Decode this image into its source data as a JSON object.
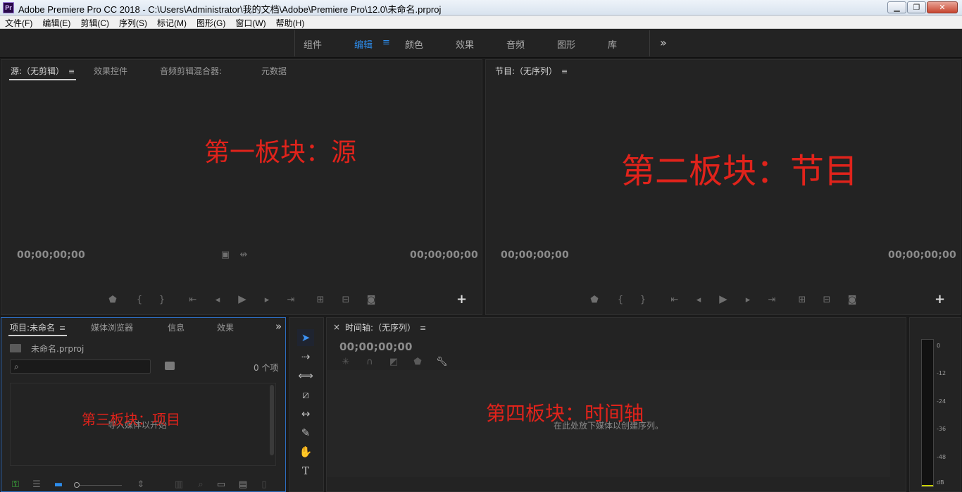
{
  "window": {
    "app_icon": "Pr",
    "title": "Adobe Premiere Pro CC 2018 - C:\\Users\\Administrator\\我的文档\\Adobe\\Premiere Pro\\12.0\\未命名.prproj",
    "minimize": "▁",
    "restore": "❐",
    "close": "✕"
  },
  "menu": [
    "文件(F)",
    "编辑(E)",
    "剪辑(C)",
    "序列(S)",
    "标记(M)",
    "图形(G)",
    "窗口(W)",
    "帮助(H)"
  ],
  "workspaces": {
    "tabs": [
      "组件",
      "编辑",
      "颜色",
      "效果",
      "音频",
      "图形",
      "库"
    ],
    "active": "编辑",
    "hamburger": "≡",
    "overflow": "»"
  },
  "source_panel": {
    "tabs": [
      "源:（无剪辑）",
      "效果控件",
      "音频剪辑混合器:",
      "元数据"
    ],
    "hamburger": "≡",
    "timecode_left": "00;00;00;00",
    "timecode_right": "00;00;00;00",
    "add": "+",
    "annotation": "第一板块：源"
  },
  "program_panel": {
    "tab": "节目:（无序列）",
    "hamburger": "≡",
    "timecode_left": "00;00;00;00",
    "timecode_right": "00;00;00;00",
    "add": "+",
    "annotation": "第二板块：节目"
  },
  "project_panel": {
    "tabs": [
      "项目:未命名",
      "媒体浏览器",
      "信息",
      "效果"
    ],
    "hamburger": "≡",
    "overflow": "»",
    "file_name": "未命名.prproj",
    "search_placeholder": "",
    "item_count": "0 个项",
    "empty_hint": "导入媒体以开始",
    "annotation": "第三板块：项目"
  },
  "timeline_panel": {
    "close": "×",
    "tab": "时间轴:（无序列）",
    "hamburger": "≡",
    "timecode": "00;00;00;00",
    "empty_hint": "在此处放下媒体以创建序列。",
    "annotation": "第四板块：时间轴"
  },
  "audio_meter": {
    "scale": [
      "0",
      "-12",
      "-24",
      "-36",
      "-48",
      "dB"
    ]
  },
  "colors": {
    "accent": "#2d8ceb",
    "annotation": "#e0231b",
    "panel_bg": "#232323"
  }
}
